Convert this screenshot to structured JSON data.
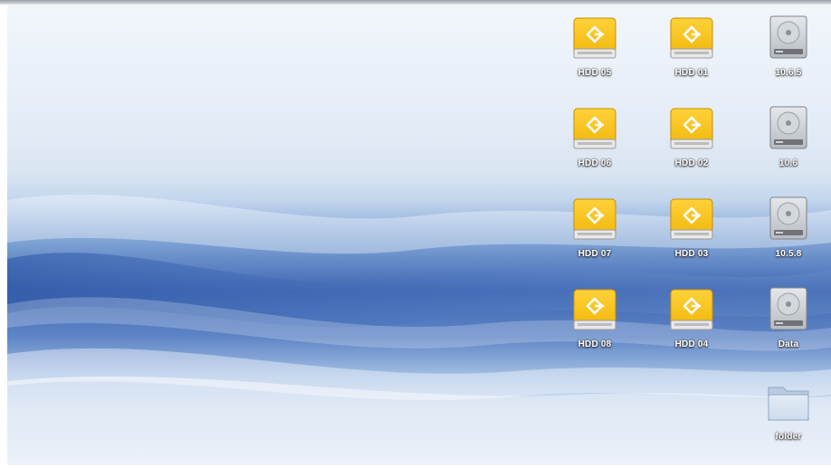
{
  "desktop": {
    "icons": [
      {
        "label": "HDD 05",
        "icon": "external-drive-icon"
      },
      {
        "label": "HDD 01",
        "icon": "external-drive-icon"
      },
      {
        "label": "10.6.5",
        "icon": "internal-disk-icon"
      },
      {
        "label": "HDD 06",
        "icon": "external-drive-icon"
      },
      {
        "label": "HDD 02",
        "icon": "external-drive-icon"
      },
      {
        "label": "10.6",
        "icon": "internal-disk-icon"
      },
      {
        "label": "HDD 07",
        "icon": "external-drive-icon"
      },
      {
        "label": "HDD 03",
        "icon": "external-drive-icon"
      },
      {
        "label": "10.5.8",
        "icon": "internal-disk-icon"
      },
      {
        "label": "HDD 08",
        "icon": "external-drive-icon"
      },
      {
        "label": "HDD 04",
        "icon": "external-drive-icon"
      },
      {
        "label": "Data",
        "icon": "internal-disk-icon"
      },
      {
        "label": "folder",
        "icon": "folder-icon"
      }
    ]
  },
  "colors": {
    "drive_yellow": "#f2b90f",
    "drive_yellow_dark": "#c98d00",
    "disk_gray": "#b8bcc2",
    "folder_blue": "#cfdcec"
  }
}
